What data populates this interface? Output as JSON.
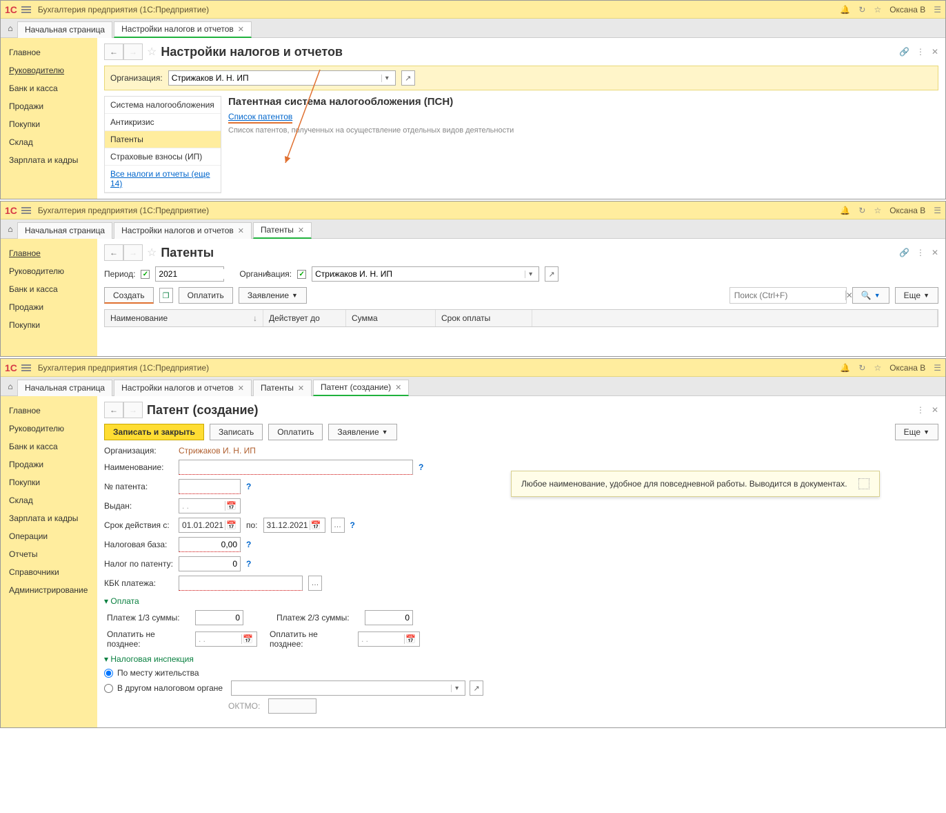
{
  "app": {
    "title": "Бухгалтерия предприятия  (1С:Предприятие)",
    "user": "Оксана В"
  },
  "tabs": {
    "home": "Начальная страница",
    "settings": "Настройки налогов и отчетов",
    "patents": "Патенты",
    "patent_create": "Патент (создание)"
  },
  "sidebar": {
    "items": [
      "Главное",
      "Руководителю",
      "Банк и касса",
      "Продажи",
      "Покупки",
      "Склад",
      "Зарплата и кадры",
      "Операции",
      "Отчеты",
      "Справочники",
      "Администрирование"
    ]
  },
  "win1": {
    "page_title": "Настройки налогов и отчетов",
    "org_label": "Организация:",
    "org_value": "Стрижаков И. Н. ИП",
    "nav": [
      "Система налогообложения",
      "Антикризис",
      "Патенты",
      "Страховые взносы (ИП)",
      "Все налоги и отчеты (еще 14)"
    ],
    "h3": "Патентная система налогообложения (ПСН)",
    "link": "Список патентов",
    "desc": "Список патентов, полученных на осуществление отдельных видов деятельности"
  },
  "win2": {
    "page_title": "Патенты",
    "period_label": "Период:",
    "period_value": "2021",
    "org_label": "Организация:",
    "org_value": "Стрижаков И. Н. ИП",
    "btn_create": "Создать",
    "btn_pay": "Оплатить",
    "btn_app": "Заявление",
    "btn_more": "Еще",
    "search_ph": "Поиск (Ctrl+F)",
    "cols": [
      "Наименование",
      "Действует до",
      "Сумма",
      "Срок оплаты"
    ]
  },
  "win3": {
    "page_title": "Патент (создание)",
    "btn_save_close": "Записать и закрыть",
    "btn_save": "Записать",
    "btn_pay": "Оплатить",
    "btn_app": "Заявление",
    "btn_more": "Еще",
    "org_label": "Организация:",
    "org_value": "Стрижаков И. Н. ИП",
    "name_label": "Наименование:",
    "num_label": "№ патента:",
    "issued_label": "Выдан:",
    "period_label": "Срок действия с:",
    "date_from": "01.01.2021",
    "to_label": "по:",
    "date_to": "31.12.2021",
    "tax_base_label": "Налоговая база:",
    "tax_base_val": "0,00",
    "tax_label": "Налог по патенту:",
    "tax_val": "0",
    "kbk_label": "КБК платежа:",
    "sec_payment": "Оплата",
    "pay13_label": "Платеж 1/3 суммы:",
    "pay13_val": "0",
    "pay23_label": "Платеж 2/3 суммы:",
    "pay23_val": "0",
    "deadline_label": "Оплатить не позднее:",
    "sec_tax_insp": "Налоговая инспекция",
    "radio1": "По месту жительства",
    "radio2": "В другом налоговом органе",
    "oktmo_label": "ОКТМО:",
    "tooltip": "Любое наименование, удобное для повседневной работы. Выводится в документах.",
    "date_ph": ".  ."
  }
}
